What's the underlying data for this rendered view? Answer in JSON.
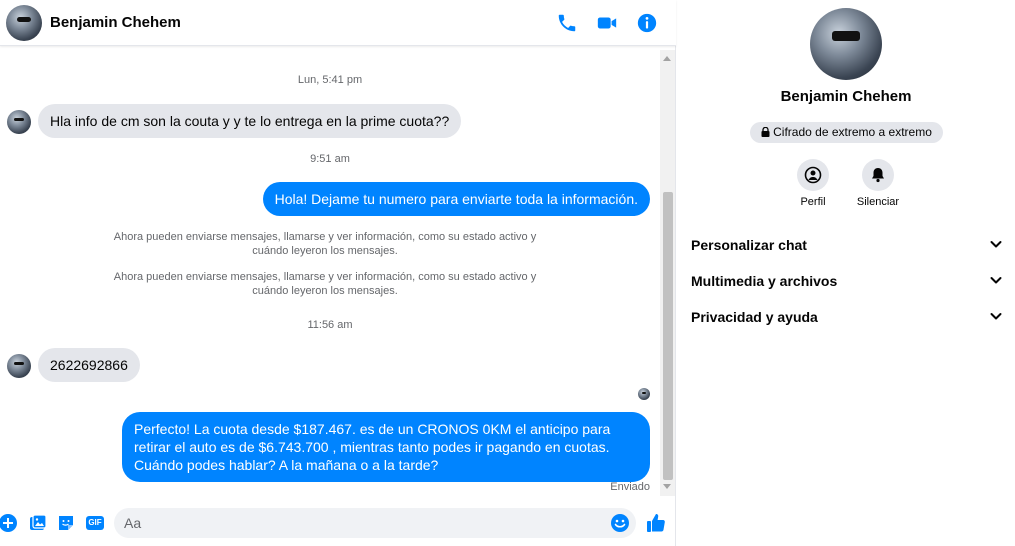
{
  "contact": {
    "name": "Benjamin Chehem"
  },
  "header": {
    "icons": [
      "phone-icon",
      "video-camera-icon",
      "info-icon"
    ]
  },
  "conversation": {
    "timestamps": [
      "Lun, 5:41 pm",
      "9:51 am",
      "11:56 am"
    ],
    "incoming": [
      "Hla info de cm son la couta y y te lo entrega en la prime cuota??",
      "2622692866"
    ],
    "outgoing": [
      "Hola! Dejame tu numero  para enviarte toda la información.",
      "Perfecto! La cuota desde $187.467. es de un CRONOS 0KM el anticipo para retirar el auto es de $6.743.700 , mientras tanto podes ir pagando en cuotas. Cuándo podes hablar? A la mañana o a la tarde?"
    ],
    "system_notes": [
      "Ahora pueden enviarse mensajes, llamarse y ver información, como su estado activo y cuándo leyeron los mensajes.",
      "Ahora pueden enviarse mensajes, llamarse y ver información, como su estado activo y cuándo leyeron los mensajes."
    ],
    "status": "Enviado"
  },
  "composer": {
    "placeholder": "Aa",
    "icons": [
      "plus-icon",
      "image-icon",
      "sticker-icon",
      "gif-icon",
      "emoji-icon",
      "like-icon"
    ],
    "gif_label": "GIF"
  },
  "info_panel": {
    "encryption": "Cifrado de extremo a extremo",
    "actions": [
      {
        "label": "Perfil",
        "icon": "profile-icon"
      },
      {
        "label": "Silenciar",
        "icon": "bell-icon"
      }
    ],
    "sections": [
      "Personalizar chat",
      "Multimedia y archivos",
      "Privacidad y ayuda"
    ]
  },
  "colors": {
    "accent": "#0084ff",
    "bubble_in": "#e4e6eb",
    "muted_text": "#65676b"
  }
}
